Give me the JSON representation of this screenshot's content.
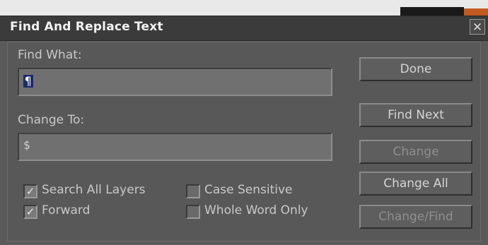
{
  "dialog": {
    "title": "Find And Replace Text",
    "close_glyph": "✕",
    "find_label": "Find What:",
    "find_value": "¶",
    "change_label": "Change To:",
    "change_value": "$",
    "buttons": {
      "done": "Done",
      "find_next": "Find Next",
      "change": "Change",
      "change_all": "Change All",
      "change_find": "Change/Find"
    },
    "options": {
      "search_all_layers": {
        "label": "Search All Layers",
        "checked": true
      },
      "forward": {
        "label": "Forward",
        "checked": true
      },
      "case_sensitive": {
        "label": "Case Sensitive",
        "checked": false
      },
      "whole_word_only": {
        "label": "Whole Word Only",
        "checked": false
      }
    },
    "check_glyph": "✓"
  }
}
